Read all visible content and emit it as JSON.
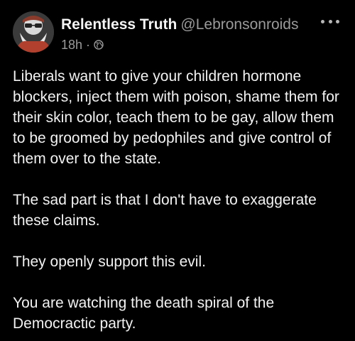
{
  "post": {
    "author": {
      "display_name": "Relentless Truth",
      "handle": "@Lebronsonroids",
      "avatar_icon": "bearded-man-sunglasses-avatar"
    },
    "meta": {
      "time": "18h",
      "separator": "·",
      "visibility_icon": "globe-icon"
    },
    "more_icon": "more-options-icon",
    "paragraphs": [
      "Liberals want to give your children hormone blockers, inject them with poison, shame them for their skin color, teach them to be gay, allow them to be groomed by pedophiles and give control of them over to the state.",
      "The sad part is that I don't have to exaggerate these claims.",
      "They openly support this evil.",
      "You are watching the death spiral of the Democractic party."
    ]
  },
  "colors": {
    "background": "#000000",
    "text": "#f2f2f2",
    "muted": "#9a9a9a"
  }
}
